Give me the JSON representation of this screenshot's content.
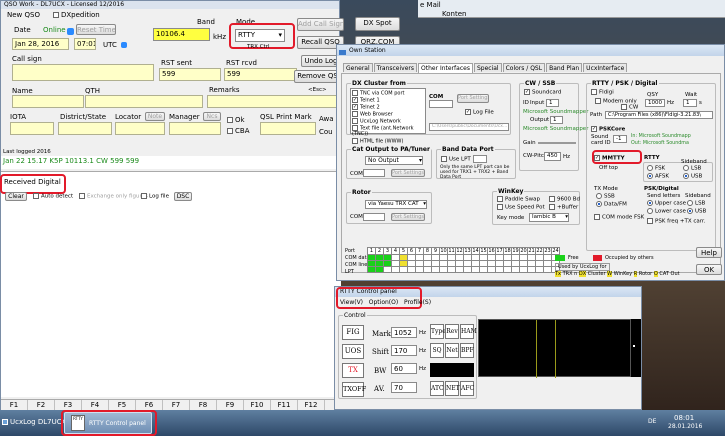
{
  "desktop": {
    "top_right": [
      "e Mail",
      "Konten"
    ]
  },
  "qso": {
    "title": "QSO Work - DL7UCX - Licensed 12/2016",
    "new_qso": "New QSO",
    "dxpedition": "DXpedition",
    "date_label": "Date",
    "online": "Online",
    "reset_time": "Reset Time",
    "date": "Jan 28, 2016",
    "time": "07:01",
    "utc": "UTC",
    "band_label": "Band",
    "freq": "10106.4",
    "khz": "kHz",
    "mode_label": "Mode",
    "mode": "RTTY",
    "trx": "TRX Ctrl",
    "add_call_sign": "Add Call Sign",
    "dx_spot": "DX Spot",
    "recall_qso": "Recall QSO",
    "qrz": "QRZ.COM",
    "call_sign_label": "Call sign",
    "rst_sent_label": "RST sent",
    "rst_rcvd_label": "RST rcvd",
    "rst_sent": "599",
    "rst_rcvd": "599",
    "undo_log": "Undo Log",
    "remove_qso": "Remove QS",
    "name_label": "Name",
    "qth_label": "QTH",
    "remarks_label": "Remarks",
    "esc": "<Esc>",
    "iota_label": "IOTA",
    "district_label": "District/State",
    "locator_label": "Locator",
    "note": "Note",
    "manager_label": "Manager",
    "ncs": "Ncs",
    "qsl_label": "QSL Print Mark",
    "ok": "Ok",
    "cba": "CBA",
    "awa": "Awa",
    "cou": "Cou",
    "last_logged_label": "Last logged 2016",
    "last_logged": "Jan 22  15.17  K5P  10113.1  CW       599  599",
    "received_digital": "Received Digital",
    "mid_buttons": {
      "clear": "Clear",
      "auto_detect": "Auto detect",
      "exchange_only": "Exchange only figures",
      "logfile": "Log file",
      "dsc": "DSC"
    },
    "fkeys": [
      "F1",
      "F2",
      "F3",
      "F4",
      "F5",
      "F6",
      "F7",
      "F8",
      "F9",
      "F10",
      "F11",
      "F12"
    ]
  },
  "own": {
    "title": "Own Station",
    "tabs": [
      "General",
      "Transceivers",
      "Other Interfaces",
      "Special",
      "Colors / QSL",
      "Band Plan",
      "UcxInterface"
    ],
    "dx_cluster": {
      "title": "DX Cluster from",
      "items": [
        "TNC via COM port",
        "Telnet 1",
        "Telnet 2",
        "Web Browser",
        "UcxLog Network",
        "Text file (ant.Network (TNC))",
        "HTML file (WWW)"
      ],
      "com": "COM",
      "port_settings": "Port Settings",
      "path": "C:\\Users\\public\\Documents\\Ucx...",
      "log_file": "Log File"
    },
    "cw": {
      "title": "CW / SSB",
      "soundcard": "Soundcard",
      "id": "ID",
      "input": "Input",
      "input_val": "1",
      "output": "Output",
      "output_val": "1",
      "ms": "Microsoft Soundmapper",
      "gain": "Gain",
      "cw_pitch": "CW-Pitch",
      "pitch": "450",
      "hz": "Hz"
    },
    "rtty": {
      "title": "RTTY / PSK / Digital",
      "fldigi": "Fldigi",
      "qsy": "QSY",
      "wait": "Wait",
      "modem_only": "Modem only",
      "cw": "CW",
      "hz": "Hz",
      "hz_val": "1000",
      "s": "s",
      "s_val": "1",
      "path_label": "Path",
      "path": "C:\\Program Files (x86)\\Fldigi-3.21.83\\",
      "pskcore": "PSKCore",
      "sound_card_id": "Sound card ID",
      "sc_val": "-1",
      "sc1": "In: Microsoft Soundmapp",
      "sc2": "Out: Microsoft Soundma",
      "mmtty": "MMTTY",
      "off_top": "Off top",
      "rtty_label": "RTTY",
      "fsk": "FSK",
      "afsk": "AFSK",
      "sideband": "Sideband",
      "lsb": "LSB",
      "usb": "USB",
      "tx_mode": "TX Mode",
      "ssb": "SSB",
      "data_fm": "Data/FM",
      "com_mode_fsk": "COM mode FSK",
      "psk_digital": "PSK/Digital",
      "send_letters": "Send letters",
      "upper": "Upper case",
      "lower": "Lower case",
      "psk_freq": "PSK freq +TX carr."
    },
    "cat": {
      "title": "Cat Output to PA/Tuner",
      "no_output": "No Output",
      "com": "COM",
      "port_settings": "Port Settings"
    },
    "band": {
      "title": "Band Data Port",
      "use_lpt": "Use LPT",
      "note": "Only the same LPT port can be used for TRX1 + TRX2 + Band Data Port"
    },
    "rotor": {
      "title": "Rotor",
      "val": "via Yaesu TRX CAT",
      "com": "COM",
      "port_settings": "Port Settings"
    },
    "winkey": {
      "title": "WinKey",
      "paddle": "Paddle Swap",
      "use_speed": "Use Speed Pot",
      "baud": "9600 Bd",
      "buffer": "+Buffer",
      "keymode": "Key mode",
      "keymode_val": "Iambic B"
    },
    "port_row": {
      "port": "Port",
      "com_data": "COM data",
      "com_lines": "COM lines",
      "lpt": "LPT",
      "nums": [
        "1",
        "2",
        "3",
        "4",
        "5",
        "6",
        "7",
        "8",
        "9",
        "10",
        "11",
        "12",
        "13",
        "14",
        "15",
        "16",
        "17",
        "18",
        "19",
        "20",
        "21",
        "22",
        "23",
        "24"
      ],
      "free": "Free",
      "occupied": "Occupied by others",
      "used_by": "Used by UcxLog for",
      "legend": [
        "Tx",
        "TRX n",
        "DX",
        "Cluster",
        "W",
        "WinKey",
        "R",
        "Rotor",
        "O",
        "CAT Out"
      ]
    },
    "help": "Help",
    "ok": "OK",
    "de": "DE"
  },
  "rtty": {
    "title": "RTTY Control panel",
    "menu": [
      "View(V)",
      "Option(O)",
      "Profile(S)"
    ],
    "control": "Control",
    "fig": "FIG",
    "uos": "UOS",
    "tx": "TX",
    "txoff": "TXOFF",
    "mark": "Mark",
    "mark_val": "1052",
    "shift": "Shift",
    "shift_val": "170",
    "bw": "BW",
    "bw_val": "60",
    "av": "AV.",
    "av_val": "70",
    "hz": "Hz",
    "type": "Type",
    "rev": "Rev",
    "ham": "HAM",
    "sq": "SQ",
    "net": "Net",
    "bpf": "BPF",
    "atc": "ATC",
    "net2": "NET",
    "afc": "AFC"
  },
  "taskbar": {
    "item1": "UcxLog DL7UCX",
    "item2": "RTTY Control panel",
    "time": "08:01",
    "date": "28.01.2016",
    "tray": "DE"
  }
}
